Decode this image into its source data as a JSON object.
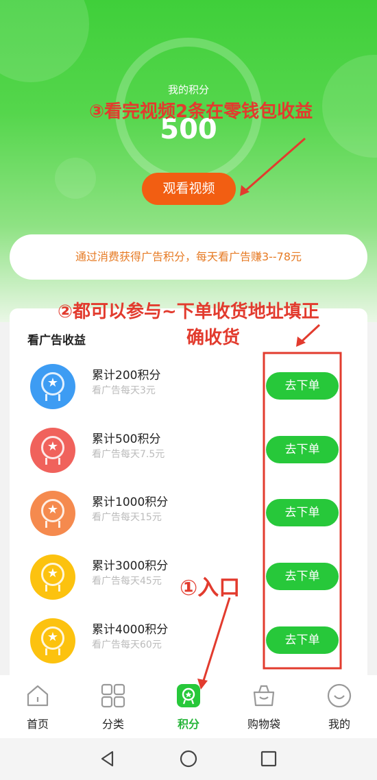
{
  "colors": {
    "accent_green": "#27c83a",
    "orange_button": "#f25e12",
    "annotation_red": "#e23b2e"
  },
  "points": {
    "label": "我的积分",
    "value": "500"
  },
  "watch_button": "观看视频",
  "notice": "通过消费获得广告积分，每天看广告赚3--78元",
  "earnings": {
    "title": "看广告收益",
    "items": [
      {
        "title": "累计200积分",
        "sub": "看广告每天3元",
        "button": "去下单",
        "color": "#3d9cf3",
        "icon": "blue-medal-icon"
      },
      {
        "title": "累计500积分",
        "sub": "看广告每天7.5元",
        "button": "去下单",
        "color": "#f0625c",
        "icon": "red-medal-icon"
      },
      {
        "title": "累计1000积分",
        "sub": "看广告每天15元",
        "button": "去下单",
        "color": "#f58a4e",
        "icon": "orange-medal-icon"
      },
      {
        "title": "累计3000积分",
        "sub": "看广告每天45元",
        "button": "去下单",
        "color": "#fcc20f",
        "icon": "gold-medal-icon"
      },
      {
        "title": "累计4000积分",
        "sub": "看广告每天60元",
        "button": "去下单",
        "color": "#fcc20f",
        "icon": "gold-medal-icon"
      }
    ]
  },
  "tabs": [
    {
      "label": "首页",
      "icon": "home-icon",
      "active": false
    },
    {
      "label": "分类",
      "icon": "grid-icon",
      "active": false
    },
    {
      "label": "积分",
      "icon": "points-icon",
      "active": true
    },
    {
      "label": "购物袋",
      "icon": "bag-icon",
      "active": false
    },
    {
      "label": "我的",
      "icon": "smile-icon",
      "active": false
    }
  ],
  "annotations": {
    "a3": "③看完视频2条在零钱包收益",
    "a2_line1": "②都可以参与~下单收货地址填正",
    "a2_line2": "确收货",
    "a1": "①入口"
  }
}
